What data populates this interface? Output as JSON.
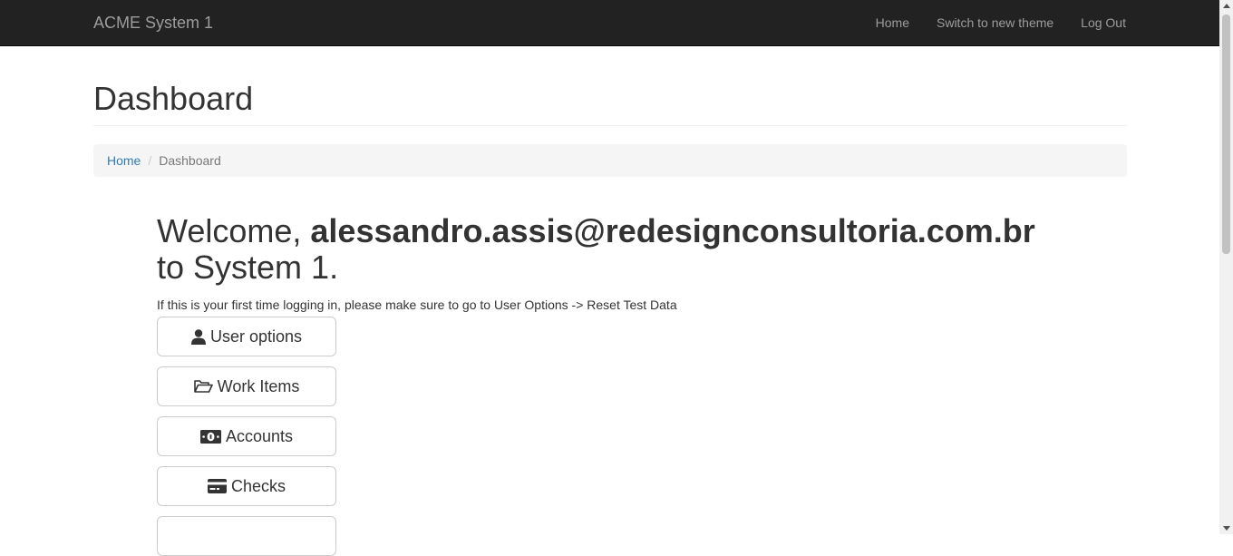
{
  "navbar": {
    "brand": "ACME System 1",
    "links": [
      "Home",
      "Switch to new theme",
      "Log Out"
    ]
  },
  "page": {
    "title": "Dashboard"
  },
  "breadcrumb": {
    "home": "Home",
    "separator": "/",
    "current": "Dashboard"
  },
  "welcome": {
    "prefix": "Welcome,",
    "user": "alessandro.assis@redesignconsultoria.com.br",
    "suffix": "to System 1.",
    "note": "If this is your first time logging in, please make sure to go to User Options -> Reset Test Data"
  },
  "buttons": [
    {
      "label": "User options",
      "icon": "user-icon"
    },
    {
      "label": "Work Items",
      "icon": "folder-open-icon"
    },
    {
      "label": "Accounts",
      "icon": "money-icon"
    },
    {
      "label": "Checks",
      "icon": "credit-card-icon"
    }
  ],
  "colors": {
    "navbar_bg": "#222222",
    "navbar_text": "#9d9d9d",
    "link": "#337ab7",
    "breadcrumb_bg": "#f5f5f5"
  }
}
